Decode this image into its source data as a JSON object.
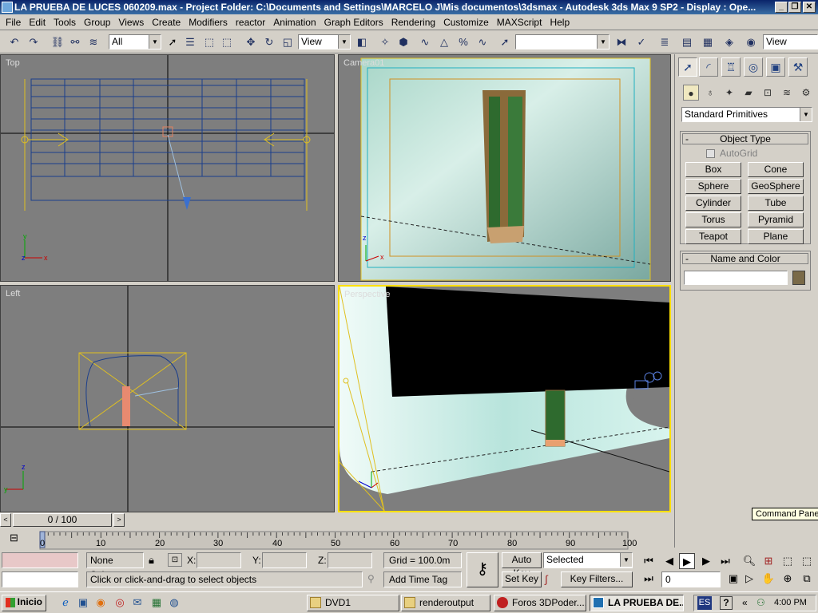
{
  "window": {
    "title": "LA PRUEBA DE LUCES 060209.max    - Project Folder: C:\\Documents and Settings\\MARCELO J\\Mis documentos\\3dsmax    - Autodesk 3ds Max 9 SP2    - Display : Ope...",
    "buttons": [
      "_",
      "❐",
      "✕"
    ]
  },
  "menu": [
    "File",
    "Edit",
    "Tools",
    "Group",
    "Views",
    "Create",
    "Modifiers",
    "reactor",
    "Animation",
    "Graph Editors",
    "Rendering",
    "Customize",
    "MAXScript",
    "Help"
  ],
  "toolbar": {
    "selection_filter": "All",
    "ref_coord": "View",
    "named_selection": "",
    "right_combo": "View"
  },
  "viewports": {
    "top": {
      "label": "Top"
    },
    "camera": {
      "label": "Camera01"
    },
    "left": {
      "label": "Left"
    },
    "perspective": {
      "label": "Perspective"
    }
  },
  "command_panel": {
    "category": "Standard Primitives",
    "object_type_title": "Object Type",
    "autogrid": "AutoGrid",
    "primitives": [
      "Box",
      "Cone",
      "Sphere",
      "GeoSphere",
      "Cylinder",
      "Tube",
      "Torus",
      "Pyramid",
      "Teapot",
      "Plane"
    ],
    "name_color_title": "Name and Color",
    "name_value": "",
    "color_swatch": "#7a6a48",
    "tooltip": "Command Panel"
  },
  "timeline": {
    "frame_display": "0 / 100",
    "ticks": [
      "0",
      "10",
      "20",
      "30",
      "40",
      "50",
      "60",
      "70",
      "80",
      "90",
      "100"
    ]
  },
  "status": {
    "selection": "None Selecte",
    "x_label": "X:",
    "y_label": "Y:",
    "z_label": "Z:",
    "x": "",
    "y": "",
    "z": "",
    "grid": "Grid = 100.0m",
    "prompt": "Click or click-and-drag to select objects",
    "add_time_tag": "Add Time Tag",
    "auto_key": "Auto Key",
    "set_key": "Set Key",
    "key_mode": "Selected",
    "key_filters": "Key Filters...",
    "current_frame": "0"
  },
  "taskbar": {
    "start": "Inicio",
    "tasks": [
      "DVD1",
      "renderoutput",
      "Foros 3DPoder....",
      "LA PRUEBA DE..."
    ],
    "lang": "ES",
    "clock": "4:00 PM"
  }
}
